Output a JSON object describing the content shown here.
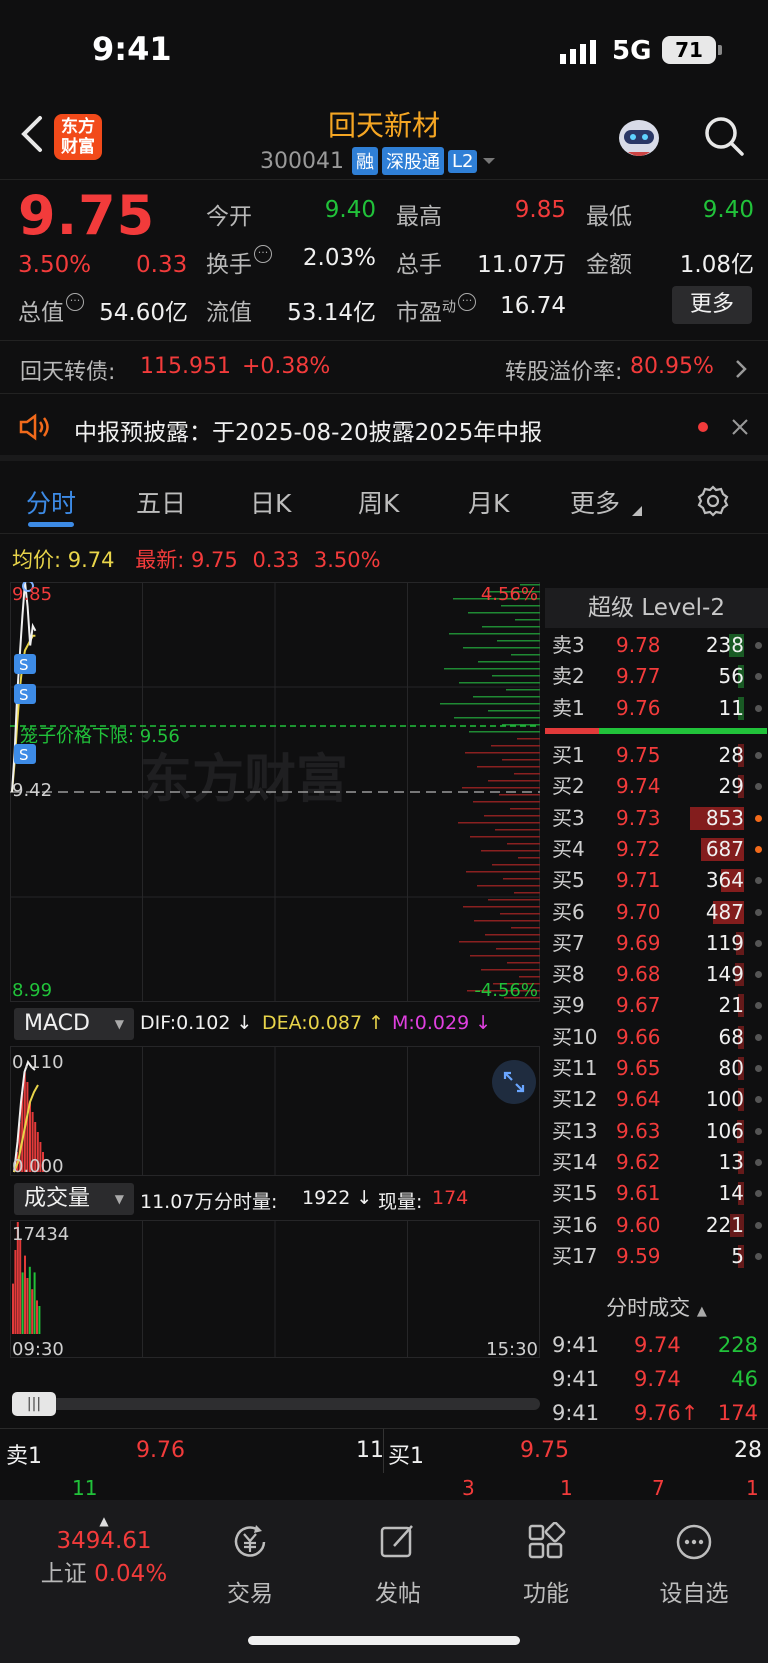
{
  "status": {
    "time": "9:41",
    "network": "5G",
    "battery": "71"
  },
  "header": {
    "logo_text": "东方财富",
    "stock_name": "回天新材",
    "stock_code": "300041",
    "tags": [
      "融",
      "深股通",
      "L2"
    ]
  },
  "quote": {
    "price": "9.75",
    "pct": "3.50%",
    "change": "0.33",
    "fields": [
      {
        "label": "今开",
        "value": "9.40",
        "color": "green"
      },
      {
        "label": "最高",
        "value": "9.85",
        "color": "red"
      },
      {
        "label": "最低",
        "value": "9.40",
        "color": "green"
      },
      {
        "label": "换手",
        "value": "2.03%",
        "color": "white"
      },
      {
        "label": "总手",
        "value": "11.07万",
        "color": "white"
      },
      {
        "label": "金额",
        "value": "1.08亿",
        "color": "white"
      },
      {
        "label": "总值",
        "value": "54.60亿",
        "color": "white"
      },
      {
        "label": "流值",
        "value": "53.14亿",
        "color": "white"
      },
      {
        "label": "市盈",
        "value": "16.74",
        "color": "white"
      }
    ],
    "pe_sup": "动",
    "more_label": "更多"
  },
  "bond": {
    "name": "回天转债:",
    "price": "115.951",
    "change": "+0.38%",
    "premium_label": "转股溢价率:",
    "premium": "80.95%"
  },
  "notice": {
    "text": "中报预披露：于2025-08-20披露2025年中报"
  },
  "tabs": [
    "分时",
    "五日",
    "日K",
    "周K",
    "月K",
    "更多"
  ],
  "avg_row": {
    "avg_label": "均价:",
    "avg": "9.74",
    "latest_label": "最新:",
    "latest": "9.75",
    "change": "0.33",
    "pct": "3.50%"
  },
  "chart_data": {
    "type": "line",
    "title": "",
    "y_top": "9.85",
    "y_ref": "9.42",
    "y_bottom": "8.99",
    "pct_top": "4.56%",
    "pct_bottom": "-4.56%",
    "cage_label": "笼子价格下限: 9.56",
    "cage_value": 9.56,
    "ylim": [
      8.99,
      9.85
    ],
    "watermark": "东方财富",
    "x_start": "09:30",
    "x_end": "15:30",
    "price_series": [
      9.42,
      9.5,
      9.62,
      9.7,
      9.78,
      9.85,
      9.8,
      9.72,
      9.76,
      9.75
    ],
    "avg_series": [
      9.42,
      9.48,
      9.56,
      9.63,
      9.68,
      9.71,
      9.72,
      9.73,
      9.74,
      9.74
    ]
  },
  "macd": {
    "label": "MACD",
    "dif": "DIF:0.102 ↓",
    "dea": "DEA:0.087 ↑",
    "m": "M:0.029 ↓",
    "y_top": "0.110",
    "y_bottom": "0.000",
    "bars": [
      0.02,
      0.05,
      0.08,
      0.1,
      0.09,
      0.07,
      0.06,
      0.05,
      0.04,
      0.03,
      0.02
    ],
    "dif_series": [
      0.0,
      0.03,
      0.07,
      0.1,
      0.11,
      0.105,
      0.102
    ],
    "dea_series": [
      0.0,
      0.01,
      0.03,
      0.05,
      0.07,
      0.08,
      0.087
    ]
  },
  "volume": {
    "label": "成交量",
    "total": "11.07万",
    "minute_label": "分时量:",
    "minute": "1922 ↓",
    "now_label": "现量:",
    "now": "174",
    "y_top": "17434",
    "bars": [
      {
        "v": 0.45,
        "c": "red"
      },
      {
        "v": 0.75,
        "c": "red"
      },
      {
        "v": 1.0,
        "c": "red"
      },
      {
        "v": 0.85,
        "c": "red"
      },
      {
        "v": 0.55,
        "c": "green"
      },
      {
        "v": 0.7,
        "c": "red"
      },
      {
        "v": 0.5,
        "c": "red"
      },
      {
        "v": 0.6,
        "c": "green"
      },
      {
        "v": 0.4,
        "c": "red"
      },
      {
        "v": 0.55,
        "c": "green"
      },
      {
        "v": 0.3,
        "c": "red"
      },
      {
        "v": 0.25,
        "c": "green"
      }
    ]
  },
  "level2": {
    "title": "超级 Level-2",
    "asks": [
      {
        "label": "卖3",
        "price": "9.78",
        "vol": "238"
      },
      {
        "label": "卖2",
        "price": "9.77",
        "vol": "56"
      },
      {
        "label": "卖1",
        "price": "9.76",
        "vol": "11"
      }
    ],
    "bids": [
      {
        "label": "买1",
        "price": "9.75",
        "vol": "28"
      },
      {
        "label": "买2",
        "price": "9.74",
        "vol": "29"
      },
      {
        "label": "买3",
        "price": "9.73",
        "vol": "853"
      },
      {
        "label": "买4",
        "price": "9.72",
        "vol": "687"
      },
      {
        "label": "买5",
        "price": "9.71",
        "vol": "364"
      },
      {
        "label": "买6",
        "price": "9.70",
        "vol": "487"
      },
      {
        "label": "买7",
        "price": "9.69",
        "vol": "119"
      },
      {
        "label": "买8",
        "price": "9.68",
        "vol": "149"
      },
      {
        "label": "买9",
        "price": "9.67",
        "vol": "21"
      },
      {
        "label": "买10",
        "price": "9.66",
        "vol": "68"
      },
      {
        "label": "买11",
        "price": "9.65",
        "vol": "80"
      },
      {
        "label": "买12",
        "price": "9.64",
        "vol": "100"
      },
      {
        "label": "买13",
        "price": "9.63",
        "vol": "106"
      },
      {
        "label": "买14",
        "price": "9.62",
        "vol": "13"
      },
      {
        "label": "买15",
        "price": "9.61",
        "vol": "14"
      },
      {
        "label": "买16",
        "price": "9.60",
        "vol": "221"
      },
      {
        "label": "买17",
        "price": "9.59",
        "vol": "5"
      }
    ]
  },
  "ticks": {
    "title": "分时成交",
    "rows": [
      {
        "time": "9:41",
        "price": "9.74",
        "vol": "228",
        "vcolor": "green"
      },
      {
        "time": "9:41",
        "price": "9.74",
        "vol": "46",
        "vcolor": "green"
      },
      {
        "time": "9:41",
        "price": "9.76↑",
        "vol": "174",
        "vcolor": "red"
      }
    ]
  },
  "askbid": {
    "ask_label": "卖1",
    "ask_price": "9.76",
    "ask_vol": "11",
    "bid_label": "买1",
    "bid_price": "9.75",
    "bid_vol": "28",
    "ask_detail": [
      "11"
    ],
    "bid_detail": [
      "3",
      "1",
      "7",
      "1"
    ]
  },
  "tabbar": {
    "index_value": "3494.61",
    "index_name": "上证",
    "index_pct": "0.04%",
    "items": [
      "交易",
      "发帖",
      "功能",
      "设自选"
    ]
  },
  "colors": {
    "up": "#f23b3b",
    "down": "#21c23a",
    "accent": "#3d8be6",
    "brand": "#f5a623"
  }
}
